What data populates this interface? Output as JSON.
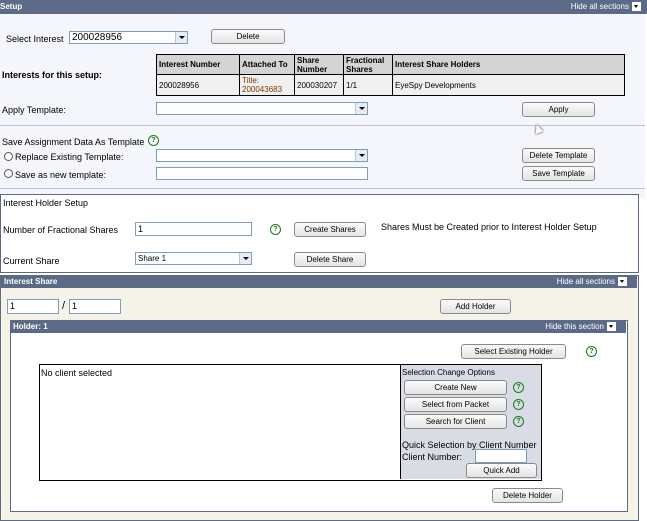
{
  "header": {
    "title": "Setup",
    "hide_all": "Hide all sections"
  },
  "select_interest": {
    "label": "Select Interest",
    "value": "200028956",
    "delete": "Delete"
  },
  "interests_table": {
    "label": "Interests for this setup:",
    "columns": [
      "Interest Number",
      "Attached To",
      "Share Number",
      "Fractional Shares",
      "Interest Share Holders"
    ],
    "row": {
      "interest_number": "200028956",
      "attached_to": "Title: 200043683",
      "share_number": "200030207",
      "fractional": "1/1",
      "holders": "EyeSpy Developments"
    }
  },
  "apply_template": {
    "label": "Apply Template:",
    "value": "",
    "button": "Apply"
  },
  "save_assignment": {
    "label": "Save Assignment Data As Template",
    "replace_label": "Replace Existing Template:",
    "replace_value": "",
    "delete_template": "Delete Template",
    "save_new_label": "Save as new template:",
    "save_new_value": "",
    "save_template": "Save Template"
  },
  "interest_holder_setup": {
    "title": "Interest Holder Setup",
    "num_fractional_label": "Number of Fractional Shares",
    "num_fractional_value": "1",
    "create_shares": "Create Shares",
    "note": "Shares Must be Created prior to Interest Holder Setup",
    "current_share_label": "Current Share",
    "current_share_value": "Share 1",
    "delete_share": "Delete Share"
  },
  "interest_share": {
    "title": "Interest Share",
    "hide_all": "Hide all sections",
    "numerator": "1",
    "slash": "/",
    "denominator": "1",
    "add_holder": "Add Holder"
  },
  "holder": {
    "title": "Holder: 1",
    "hide_this": "Hide this section",
    "select_existing": "Select Existing Holder",
    "no_client": "No client selected",
    "options_title": "Selection Change Options",
    "create_new": "Create New",
    "select_packet": "Select from Packet",
    "search_client": "Search for Client",
    "quick_title": "Quick Selection by Client Number",
    "client_number_label": "Client Number:",
    "client_number_value": "",
    "quick_add": "Quick Add",
    "delete_holder": "Delete Holder"
  },
  "colors": {
    "header_bg": "#5b6b87",
    "panel_bg": "#f5f3e7",
    "help_green": "#1c7a1c"
  }
}
